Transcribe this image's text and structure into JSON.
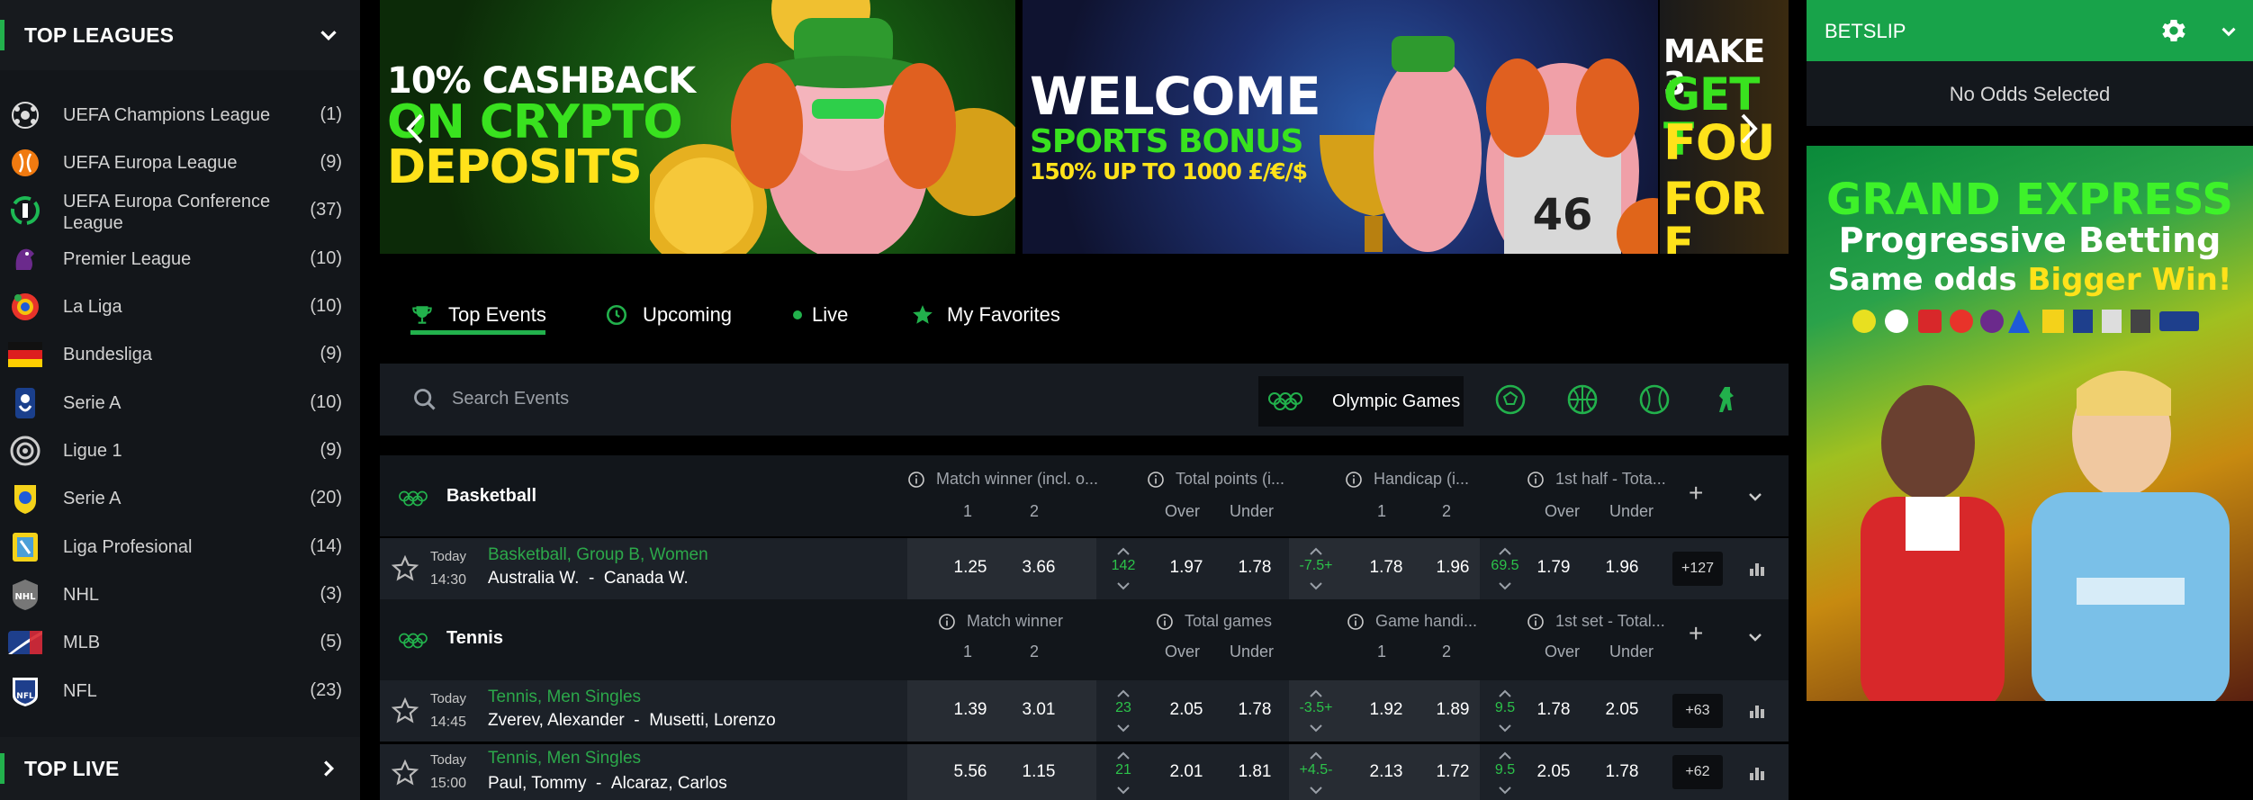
{
  "sidebar": {
    "top_leagues_title": "TOP LEAGUES",
    "top_live_title": "TOP LIVE",
    "leagues": [
      {
        "name": "UEFA Champions League",
        "count": "(1)",
        "icon": "champions-league-icon"
      },
      {
        "name": "UEFA Europa League",
        "count": "(9)",
        "icon": "europa-league-icon"
      },
      {
        "name": "UEFA Europa Conference League",
        "count": "(37)",
        "icon": "conference-league-icon"
      },
      {
        "name": "Premier League",
        "count": "(10)",
        "icon": "premier-league-icon"
      },
      {
        "name": "La Liga",
        "count": "(10)",
        "icon": "la-liga-icon"
      },
      {
        "name": "Bundesliga",
        "count": "(9)",
        "icon": "germany-flag-icon"
      },
      {
        "name": "Serie A",
        "count": "(10)",
        "icon": "serie-a-icon"
      },
      {
        "name": "Ligue 1",
        "count": "(9)",
        "icon": "ligue-1-icon"
      },
      {
        "name": "Serie A",
        "count": "(20)",
        "icon": "brasileirao-icon"
      },
      {
        "name": "Liga Profesional",
        "count": "(14)",
        "icon": "liga-profesional-icon"
      },
      {
        "name": "NHL",
        "count": "(3)",
        "icon": "nhl-icon"
      },
      {
        "name": "MLB",
        "count": "(5)",
        "icon": "mlb-icon"
      },
      {
        "name": "NFL",
        "count": "(23)",
        "icon": "nfl-icon"
      }
    ]
  },
  "banners": {
    "b1": {
      "l1": "10% CASHBACK",
      "l2": "ON CRYPTO",
      "l3": "DEPOSITS"
    },
    "b2": {
      "l1": "WELCOME",
      "l2": "SPORTS BONUS",
      "l3": "150% UP TO 1000 £/€/$"
    },
    "b3": {
      "l1": "MAKE 3",
      "l2": "GET T",
      "l3": "FOU",
      "l4": "FOR F"
    }
  },
  "tabs": [
    {
      "label": "Top Events",
      "icon": "trophy-icon"
    },
    {
      "label": "Upcoming",
      "icon": "clock-icon"
    },
    {
      "label": "Live",
      "icon": "live-dot-icon"
    },
    {
      "label": "My Favorites",
      "icon": "star-icon"
    }
  ],
  "search": {
    "placeholder": "Search Events",
    "filter_label": "Olympic Games"
  },
  "sports": [
    {
      "name": "Basketball",
      "markets": [
        {
          "title": "Match winner (incl. o...",
          "sub": [
            "1",
            "2"
          ]
        },
        {
          "title": "Total points (i...",
          "sub": [
            "Over",
            "Under"
          ]
        },
        {
          "title": "Handicap (i...",
          "sub": [
            "1",
            "2"
          ]
        },
        {
          "title": "1st half - Tota...",
          "sub": [
            "Over",
            "Under"
          ]
        }
      ],
      "events": [
        {
          "day": "Today",
          "time": "14:30",
          "competition": "Basketball, Group B, Women",
          "team1": "Australia W.",
          "sep": "-",
          "team2": "Canada W.",
          "odds": [
            "1.25",
            "3.66",
            "142",
            "1.97",
            "1.78",
            "-7.5+",
            "1.78",
            "1.96",
            "69.5",
            "1.79",
            "1.96"
          ],
          "more": "+127"
        }
      ]
    },
    {
      "name": "Tennis",
      "markets": [
        {
          "title": "Match winner",
          "sub": [
            "1",
            "2"
          ]
        },
        {
          "title": "Total games",
          "sub": [
            "Over",
            "Under"
          ]
        },
        {
          "title": "Game handi...",
          "sub": [
            "1",
            "2"
          ]
        },
        {
          "title": "1st set - Total...",
          "sub": [
            "Over",
            "Under"
          ]
        }
      ],
      "events": [
        {
          "day": "Today",
          "time": "14:45",
          "competition": "Tennis, Men Singles",
          "team1": "Zverev, Alexander",
          "sep": "-",
          "team2": "Musetti, Lorenzo",
          "odds": [
            "1.39",
            "3.01",
            "23",
            "2.05",
            "1.78",
            "-3.5+",
            "1.92",
            "1.89",
            "9.5",
            "1.78",
            "2.05"
          ],
          "more": "+63"
        },
        {
          "day": "Today",
          "time": "15:00",
          "competition": "Tennis, Men Singles",
          "team1": "Paul, Tommy",
          "sep": "-",
          "team2": "Alcaraz, Carlos",
          "odds": [
            "5.56",
            "1.15",
            "21",
            "2.01",
            "1.81",
            "+4.5-",
            "2.13",
            "1.72",
            "9.5",
            "2.05",
            "1.78"
          ],
          "more": "+62"
        }
      ]
    }
  ],
  "betslip": {
    "title": "BETSLIP",
    "empty_text": "No Odds Selected"
  },
  "promo": {
    "l1": "GRAND EXPRESS",
    "l2": "Progressive Betting",
    "l3a": "Same odds ",
    "l3b": "Bigger Win!"
  },
  "colors": {
    "accent": "#22b14c",
    "betslip": "#18a34a",
    "odds_line": "#2cc34a"
  }
}
